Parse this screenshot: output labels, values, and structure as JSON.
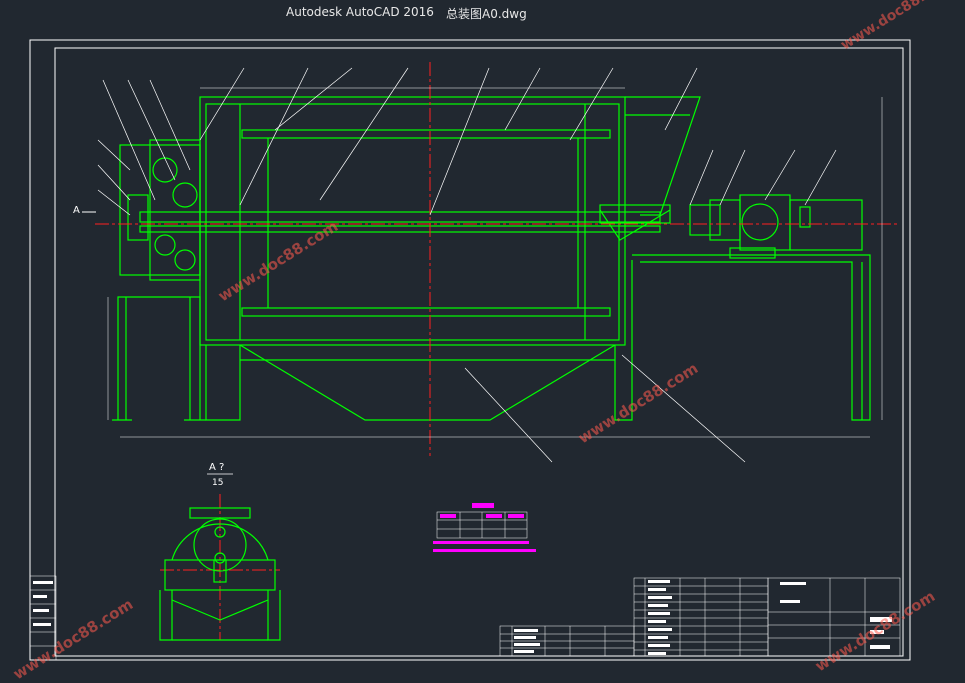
{
  "window": {
    "app_title": "Autodesk AutoCAD 2016",
    "file_name": "总装图A0.dwg"
  },
  "drawing": {
    "section_label": "A",
    "section_view_label": "A ?",
    "section_scale": "15"
  },
  "watermark": {
    "text": "www.doc88.com",
    "color": "#ff5a4e"
  },
  "colors": {
    "background": "#212830",
    "frame": "#ffffff",
    "geometry": "#00ff00",
    "centerline": "#ff2020",
    "highlight": "#ff00ff"
  }
}
